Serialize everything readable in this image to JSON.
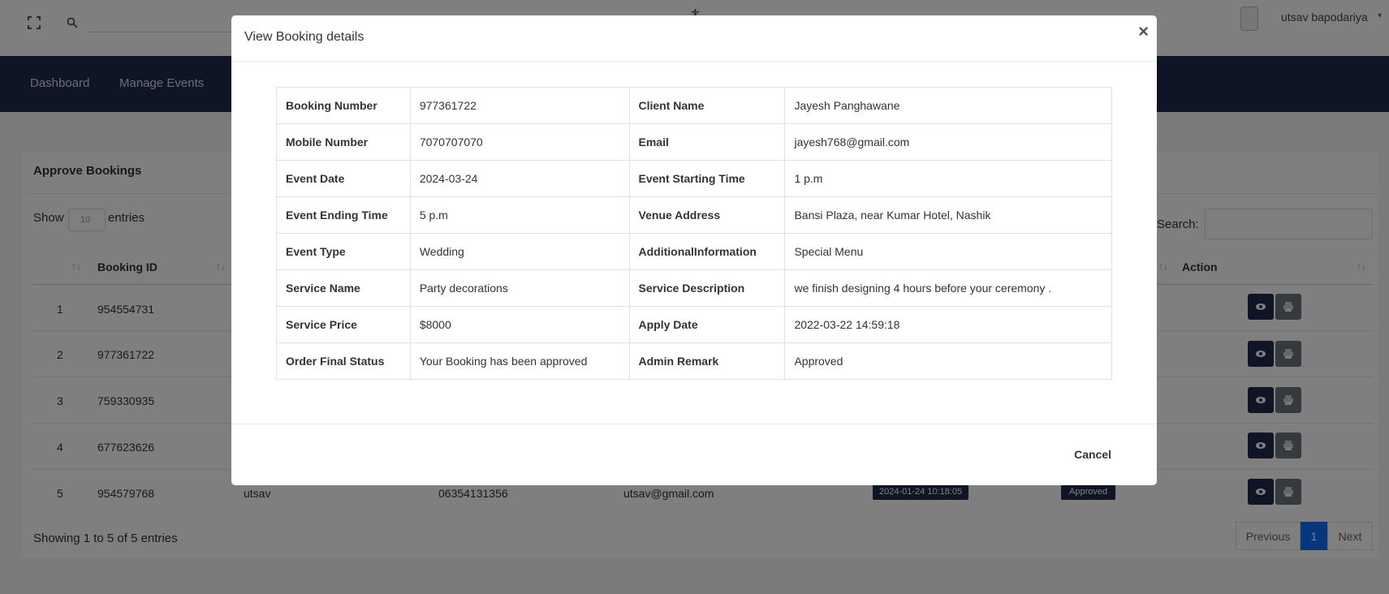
{
  "header": {
    "user_name": "utsav bapodariya"
  },
  "nav": {
    "items": [
      "Dashboard",
      "Manage Events"
    ]
  },
  "card": {
    "title": "Approve Bookings",
    "show_label": "Show",
    "show_value": "10",
    "entries_label": "entries",
    "search_label": "Search:",
    "columns": {
      "booking_id": "Booking ID",
      "action": "Action"
    },
    "rows": [
      {
        "num": "1",
        "booking_id": "954554731"
      },
      {
        "num": "2",
        "booking_id": "977361722"
      },
      {
        "num": "3",
        "booking_id": "759330935"
      },
      {
        "num": "4",
        "booking_id": "677623626"
      },
      {
        "num": "5",
        "booking_id": "954579768",
        "name": "utsav",
        "mobile": "06354131356",
        "email": "utsav@gmail.com",
        "date": "2024-01-24 10:18:05",
        "status": "Approved"
      }
    ],
    "info": "Showing 1 to 5 of 5 entries",
    "pagination": {
      "previous": "Previous",
      "page": "1",
      "next": "Next"
    }
  },
  "modal": {
    "title": "View Booking details",
    "close": "×",
    "cancel": "Cancel",
    "details": [
      {
        "l1": "Booking Number",
        "v1": "977361722",
        "l2": "Client Name",
        "v2": "Jayesh Panghawane"
      },
      {
        "l1": "Mobile Number",
        "v1": "7070707070",
        "l2": "Email",
        "v2": "jayesh768@gmail.com"
      },
      {
        "l1": "Event Date",
        "v1": "2024-03-24",
        "l2": "Event Starting Time",
        "v2": "1 p.m"
      },
      {
        "l1": "Event Ending Time",
        "v1": "5 p.m",
        "l2": "Venue Address",
        "v2": "Bansi Plaza, near Kumar Hotel, Nashik"
      },
      {
        "l1": "Event Type",
        "v1": "Wedding",
        "l2": "AdditionalInformation",
        "v2": "Special Menu"
      },
      {
        "l1": "Service Name",
        "v1": "Party decorations",
        "l2": "Service Description",
        "v2": "we finish designing 4 hours before your ceremony ."
      },
      {
        "l1": "Service Price",
        "v1": "$8000",
        "l2": "Apply Date",
        "v2": "2022-03-22 14:59:18"
      },
      {
        "l1": "Order Final Status",
        "v1": "Your Booking has been approved",
        "l2": "Admin Remark",
        "v2": "Approved"
      }
    ]
  },
  "colors": {
    "navbar": "#1e2a4a",
    "primary": "#0d6efd",
    "overlay": "rgba(0,0,0,0.5)"
  }
}
